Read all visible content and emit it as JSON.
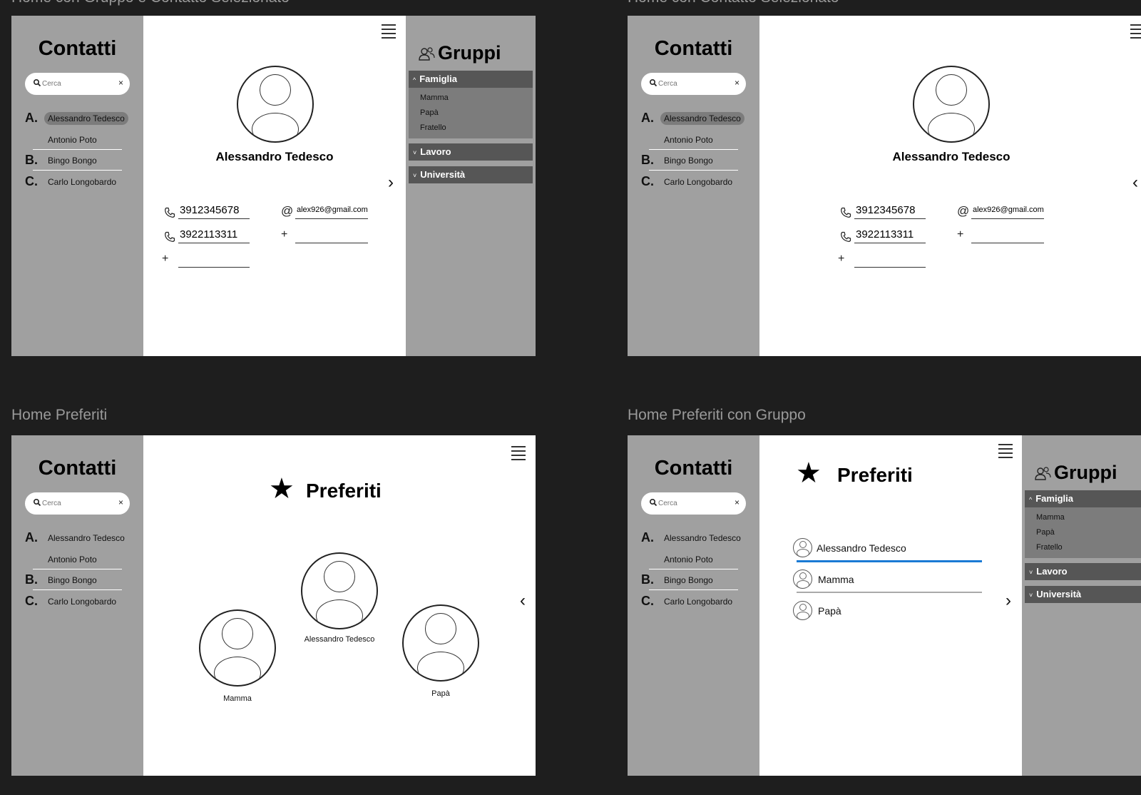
{
  "frames": [
    {
      "title": "Home con Gruppo e Contatto Selezionato"
    },
    {
      "title": "Home con Contatto Selezionato"
    },
    {
      "title": "Home Preferiti"
    },
    {
      "title": "Home Preferiti con Gruppo"
    }
  ],
  "sidebar": {
    "title": "Contatti",
    "search_placeholder": "Cerca",
    "clear_icon": "×",
    "sections": [
      {
        "letter": "A.",
        "contacts": [
          "Alessandro Tedesco",
          "Antonio Poto"
        ]
      },
      {
        "letter": "B.",
        "contacts": [
          "Bingo Bongo"
        ]
      },
      {
        "letter": "C.",
        "contacts": [
          "Carlo Longobardo"
        ]
      }
    ]
  },
  "contact_detail": {
    "name": "Alessandro Tedesco",
    "phones": [
      "3912345678",
      "3922113311"
    ],
    "email": "alex926@gmail.com",
    "add_icon": "+"
  },
  "groups": {
    "title": "Gruppi",
    "items": [
      {
        "name": "Famiglia",
        "expanded": true,
        "arrow": "^",
        "members": [
          "Mamma",
          "Papà",
          "Fratello"
        ]
      },
      {
        "name": "Lavoro",
        "expanded": false,
        "arrow": "˅"
      },
      {
        "name": "Università",
        "expanded": false,
        "arrow": "˅"
      }
    ]
  },
  "favorites": {
    "title": "Preferiti",
    "star": "★",
    "contacts": [
      "Alessandro Tedesco",
      "Mamma",
      "Papà"
    ],
    "selected": "Alessandro Tedesco"
  },
  "icons": {
    "chevron_right": "›",
    "chevron_left": "‹",
    "menu": "hamburger-icon",
    "phone": "phone-icon",
    "email": "at-icon",
    "search": "search-icon",
    "groups": "people-icon"
  },
  "colors": {
    "canvas": "#1e1e1e",
    "sidebar": "#a0a0a0",
    "selected_contact": "#7c7c7c",
    "group_header": "#565656",
    "group_members": "#7c7c7c",
    "accent_underline": "#1a7ad4"
  }
}
